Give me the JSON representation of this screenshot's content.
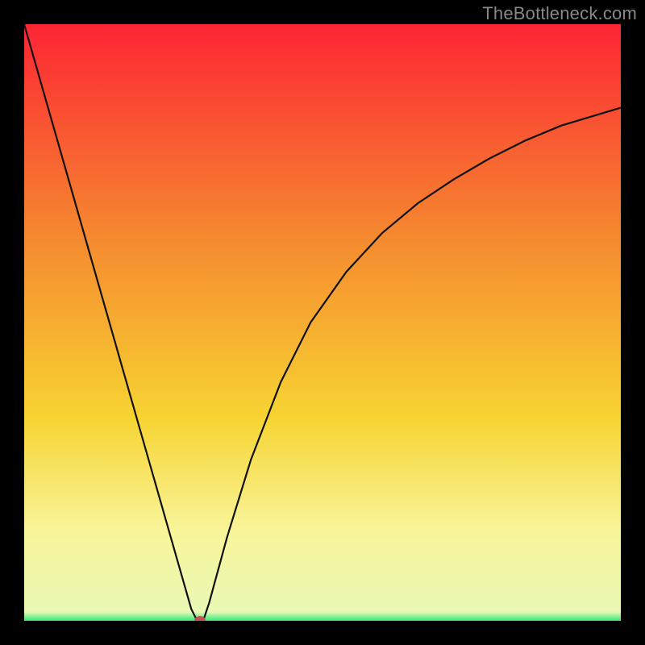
{
  "watermark": "TheBottleneck.com",
  "colors": {
    "frame": "#000000",
    "gradient_top": "#fd2534",
    "gradient_mid1": "#f58a2f",
    "gradient_mid2": "#f7d432",
    "gradient_mid3": "#f8f59a",
    "gradient_bottom": "#2fe97a",
    "curve": "#111111",
    "marker": "#c0544f"
  },
  "chart_data": {
    "type": "line",
    "title": "",
    "xlabel": "",
    "ylabel": "",
    "xlim": [
      0,
      100
    ],
    "ylim": [
      0,
      100
    ],
    "grid": false,
    "x": [
      0,
      2,
      5,
      8,
      11,
      14,
      17,
      20,
      23,
      26,
      27,
      28,
      29,
      30,
      31,
      34,
      38,
      43,
      48,
      54,
      60,
      66,
      72,
      78,
      84,
      90,
      95,
      100
    ],
    "values": [
      100,
      93,
      82.5,
      72,
      61.5,
      51,
      40.5,
      30,
      19.5,
      9,
      5.5,
      2,
      0,
      0,
      3,
      14,
      27,
      40,
      50,
      58.5,
      65,
      70,
      74,
      77.5,
      80.5,
      83,
      84.5,
      86
    ],
    "marker": {
      "x": 29.5,
      "y": 0
    },
    "background_gradient_stops": [
      {
        "offset": 0.0,
        "color": "#fd2534"
      },
      {
        "offset": 0.36,
        "color": "#f58a2f"
      },
      {
        "offset": 0.66,
        "color": "#f7d432"
      },
      {
        "offset": 0.85,
        "color": "#f8f59a"
      },
      {
        "offset": 0.985,
        "color": "#e9f9b5"
      },
      {
        "offset": 1.0,
        "color": "#2fe97a"
      }
    ]
  }
}
